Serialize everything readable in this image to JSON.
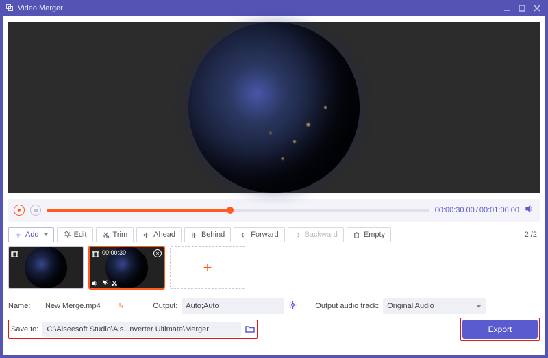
{
  "titlebar": {
    "title": "Video Merger"
  },
  "playback": {
    "current_time": "00:00:30.00",
    "total_time": "00:01:00.00"
  },
  "toolbar": {
    "add": "Add",
    "edit": "Edit",
    "trim": "Trim",
    "ahead": "Ahead",
    "behind": "Behind",
    "forward": "Forward",
    "backward": "Backward",
    "empty": "Empty",
    "clip_index": "2",
    "clip_total": "2"
  },
  "clips": [
    {
      "duration": ""
    },
    {
      "duration": "00:00:30"
    }
  ],
  "settings": {
    "name_label": "Name:",
    "name_value": "New Merge.mp4",
    "output_label": "Output:",
    "output_value": "Auto;Auto",
    "audio_label": "Output audio track:",
    "audio_value": "Original Audio",
    "save_label": "Save to:",
    "save_path": "C:\\Aiseesoft Studio\\Ais...nverter Ultimate\\Merger",
    "export": "Export"
  }
}
